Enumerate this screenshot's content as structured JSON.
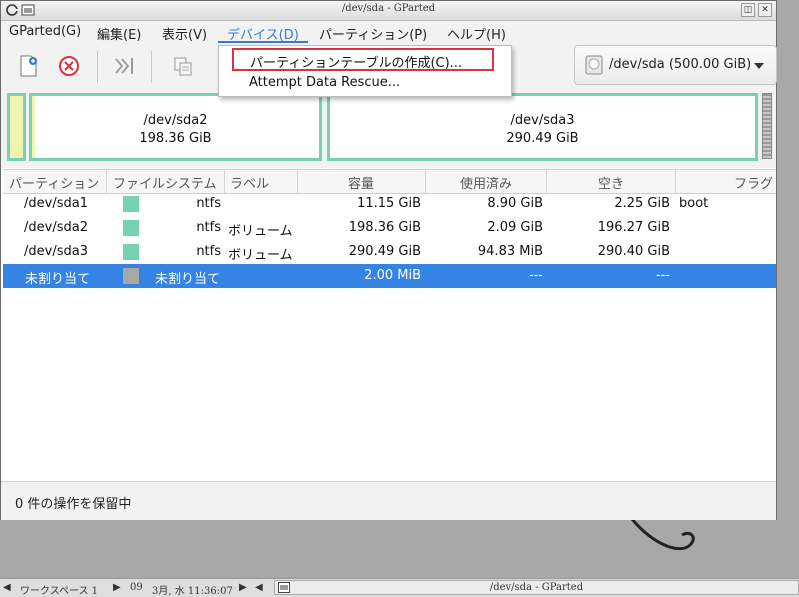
{
  "window": {
    "title": "/dev/sda - GParted",
    "btn_left": "◫",
    "btn_mid": "▭",
    "btn_right": "✕"
  },
  "menubar": {
    "items": [
      "GParted(G)",
      "編集(E)",
      "表示(V)",
      "デバイス(D)",
      "パーティション(P)",
      "ヘルプ(H)"
    ],
    "active_index": 3
  },
  "toolbar": {
    "device_label": "/dev/sda (500.00 GiB)",
    "icons": [
      "new-partition-icon",
      "delete-icon",
      "apply-icon",
      "copy-icon"
    ]
  },
  "dropdown": {
    "item1": "パーティションテーブルの作成(C)...",
    "item2": "Attempt Data Rescue..."
  },
  "graphic": {
    "sda2": {
      "name": "/dev/sda2",
      "size": "198.36 GiB"
    },
    "sda3": {
      "name": "/dev/sda3",
      "size": "290.49 GiB"
    }
  },
  "table": {
    "headers": [
      "パーティション",
      "ファイルシステム",
      "ラベル",
      "容量",
      "使用済み",
      "空き",
      "フラグ"
    ],
    "rows": [
      {
        "partition": "/dev/sda1",
        "color": "#77d2b4",
        "fs": "ntfs",
        "label": "",
        "size": "11.15 GiB",
        "used": "8.90 GiB",
        "free": "2.25 GiB",
        "flags": "boot"
      },
      {
        "partition": "/dev/sda2",
        "color": "#77d2b4",
        "fs": "ntfs",
        "label": "ボリューム",
        "size": "198.36 GiB",
        "used": "2.09 GiB",
        "free": "196.27 GiB",
        "flags": ""
      },
      {
        "partition": "/dev/sda3",
        "color": "#77d2b4",
        "fs": "ntfs",
        "label": "ボリューム",
        "size": "290.49 GiB",
        "used": "94.83 MiB",
        "free": "290.40 GiB",
        "flags": ""
      },
      {
        "partition": "未割り当て",
        "color": "#a8a8a8",
        "fs": "未割り当て",
        "label": "",
        "size": "2.00 MiB",
        "used": "---",
        "free": "---",
        "flags": ""
      }
    ],
    "selected_index": 3
  },
  "status": {
    "text": "0 件の操作を保留中"
  },
  "taskbar": {
    "workspace": "ワークスペース 1",
    "arrow_left": "◀",
    "arrow_right": "▶",
    "day": "09",
    "datetime": "3月, 水 11:36:07",
    "task_title": "/dev/sda - GParted"
  },
  "colors": {
    "accent": "#3584e4",
    "partition_ntfs": "#77d2b4",
    "highlight_border": "#d9333d"
  }
}
